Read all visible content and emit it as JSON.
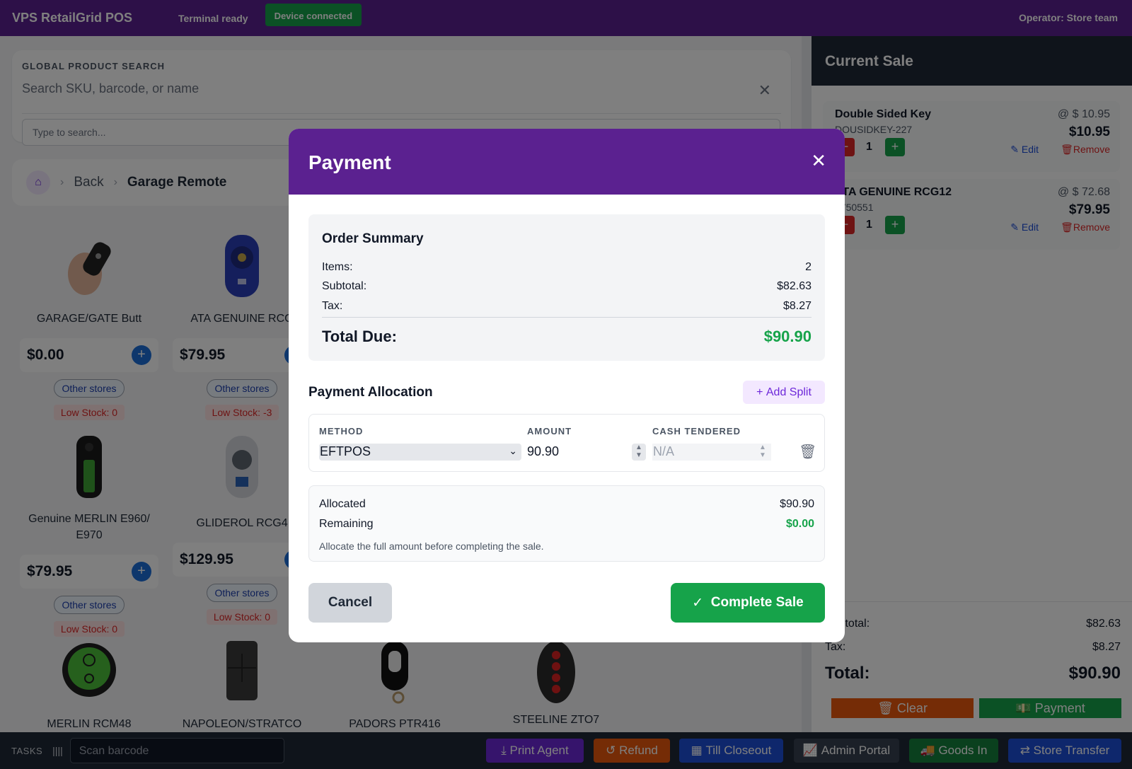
{
  "app": {
    "title": "VPS RetailGrid POS",
    "terminal_status": "Terminal ready",
    "device_status": "Device connected",
    "operator": "Operator: Store team"
  },
  "search": {
    "label": "GLOBAL PRODUCT SEARCH",
    "big_placeholder": "Search SKU, barcode, or name",
    "input_placeholder": "Type to search..."
  },
  "breadcrumb": {
    "back": "Back",
    "current": "Garage Remote"
  },
  "products": [
    {
      "name": "GARAGE/GATE Butt",
      "price": "$0.00",
      "other": "Other stores",
      "stock": "Low Stock: 0"
    },
    {
      "name": "ATA GENUINE RCG",
      "price": "$79.95",
      "other": "Other stores",
      "stock": "Low Stock: -3"
    },
    {
      "name": "Genuine MERLIN E960/ E970",
      "price": "$79.95",
      "other": "Other stores",
      "stock": "Low Stock: 0"
    },
    {
      "name": "GLIDEROL RCG4",
      "price": "$129.95",
      "other": "Other stores",
      "stock": "Low Stock: 0"
    },
    {
      "name": "MERLIN RCM48"
    },
    {
      "name": "NAPOLEON/STRATCO"
    },
    {
      "name": "PADORS PTR416"
    },
    {
      "name": "STEELINE ZTO7"
    }
  ],
  "sale": {
    "title": "Current Sale",
    "items": [
      {
        "name": "Double Sided Key",
        "sku": "DOUSIDKEY-227",
        "unit": "@ $ 10.95",
        "total": "$10.95",
        "qty": "1"
      },
      {
        "name": "ATA GENUINE RCG12",
        "sku": "5750551",
        "unit": "@ $ 72.68",
        "total": "$79.95",
        "qty": "1"
      }
    ],
    "edit_label": "Edit",
    "remove_label": "Remove",
    "subtotal_label": "Subtotal:",
    "subtotal": "$82.63",
    "tax_label": "Tax:",
    "tax": "$8.27",
    "total_label": "Total:",
    "total": "$90.90",
    "clear_label": "Clear",
    "payment_label": "Payment"
  },
  "bottom": {
    "tasks": "TASKS",
    "scan_placeholder": "Scan barcode",
    "buttons": [
      {
        "label": "Print Agent",
        "color": "#6d28d9"
      },
      {
        "label": "Refund",
        "color": "#ea580c"
      },
      {
        "label": "Till Closeout",
        "color": "#1d4ed8"
      },
      {
        "label": "Admin Portal",
        "color": "#374151"
      },
      {
        "label": "Goods In",
        "color": "#15803d"
      },
      {
        "label": "Store Transfer",
        "color": "#1d4ed8"
      }
    ]
  },
  "modal": {
    "title": "Payment",
    "summary": {
      "title": "Order Summary",
      "items_label": "Items:",
      "items": "2",
      "subtotal_label": "Subtotal:",
      "subtotal": "$82.63",
      "tax_label": "Tax:",
      "tax": "$8.27",
      "due_label": "Total Due:",
      "due": "$90.90"
    },
    "allocation_title": "Payment Allocation",
    "add_split": "Add Split",
    "method_header": "METHOD",
    "amount_header": "AMOUNT",
    "cash_header": "CASH TENDERED",
    "method": "EFTPOS",
    "amount": "90.90",
    "cash": "N/A",
    "allocated_label": "Allocated",
    "allocated": "$90.90",
    "remaining_label": "Remaining",
    "remaining": "$0.00",
    "hint": "Allocate the full amount before completing the sale.",
    "cancel": "Cancel",
    "complete": "Complete Sale"
  },
  "colors": {
    "brand": "#5b2190",
    "success": "#16a34a",
    "danger": "#dc2626"
  }
}
